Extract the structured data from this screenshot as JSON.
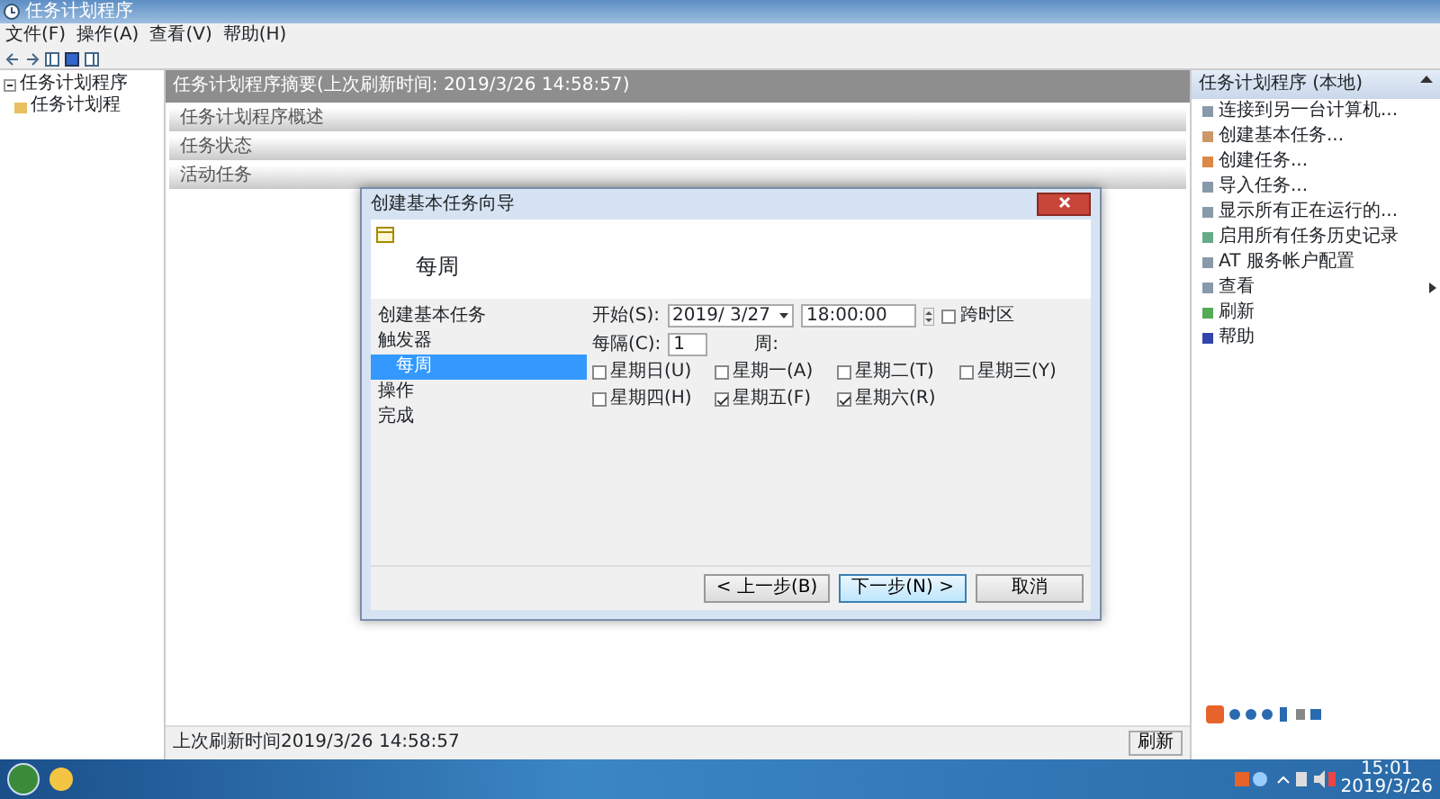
{
  "window": {
    "title": "任务计划程序"
  },
  "menu": [
    "文件(F)",
    "操作(A)",
    "查看(V)",
    "帮助(H)"
  ],
  "tree": [
    {
      "label": "任务计划程序",
      "children": [
        {
          "label": "任务计划程"
        }
      ]
    }
  ],
  "summary": {
    "header": "任务计划程序摘要(上次刷新时间: 2019/3/26 14:58:57)",
    "sections": [
      "任务计划程序概述",
      "任务状态",
      "活动任务"
    ],
    "last_refresh": "上次刷新时间2019/3/26 14:58:57",
    "refresh_button": "刷新"
  },
  "actions": {
    "header": "任务计划程序 (本地)",
    "items": [
      {
        "label": "连接到另一台计算机...",
        "submenu": false
      },
      {
        "label": "创建基本任务...",
        "submenu": false
      },
      {
        "label": "创建任务...",
        "submenu": false
      },
      {
        "label": "导入任务...",
        "submenu": false
      },
      {
        "label": "显示所有正在运行的...",
        "submenu": false
      },
      {
        "label": "启用所有任务历史记录",
        "submenu": false
      },
      {
        "label": "AT 服务帐户配置",
        "submenu": false
      },
      {
        "label": "查看",
        "submenu": true
      },
      {
        "label": "刷新",
        "submenu": false
      },
      {
        "label": "帮助",
        "submenu": false
      }
    ]
  },
  "dialog": {
    "title": "创建基本任务向导",
    "heading": "每周",
    "steps": [
      {
        "label": "创建基本任务",
        "selected": false
      },
      {
        "label": "触发器",
        "selected": false
      },
      {
        "label": "每周",
        "selected": true
      },
      {
        "label": "操作",
        "selected": false
      },
      {
        "label": "完成",
        "selected": false
      }
    ],
    "start_label": "开始(S):",
    "start_date": "2019/ 3/27",
    "start_time": "18:00:00",
    "timezone": {
      "label": "跨时区",
      "checked": false
    },
    "recur_label": "每隔(C):",
    "recur_value": "1",
    "recur_unit": "周:",
    "days": [
      {
        "label": "星期日(U)",
        "checked": false
      },
      {
        "label": "星期一(A)",
        "checked": false
      },
      {
        "label": "星期二(T)",
        "checked": false
      },
      {
        "label": "星期三(Y)",
        "checked": false
      },
      {
        "label": "星期四(H)",
        "checked": false
      },
      {
        "label": "星期五(F)",
        "checked": true
      },
      {
        "label": "星期六(R)",
        "checked": true
      }
    ],
    "buttons": [
      {
        "label": "< 上一步(B)",
        "default": false
      },
      {
        "label": "下一步(N) >",
        "default": true
      },
      {
        "label": "取消",
        "default": false
      }
    ]
  },
  "taskbar": {
    "time": "15:01",
    "date": "2019/3/26"
  }
}
